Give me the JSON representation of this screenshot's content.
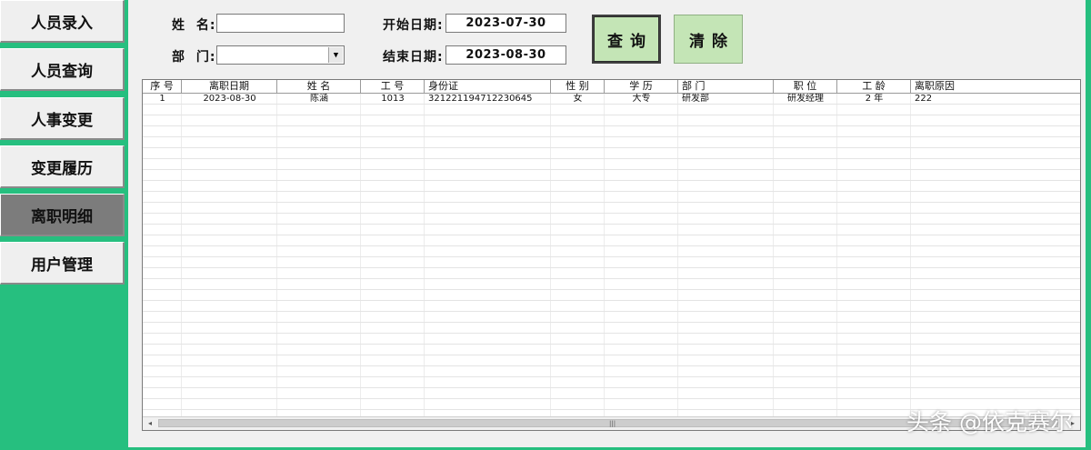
{
  "sidebar": {
    "items": [
      {
        "label": "人员录入",
        "active": false
      },
      {
        "label": "人员查询",
        "active": false
      },
      {
        "label": "人事变更",
        "active": false
      },
      {
        "label": "变更履历",
        "active": false
      },
      {
        "label": "离职明细",
        "active": true
      },
      {
        "label": "用户管理",
        "active": false
      }
    ]
  },
  "form": {
    "name_label": "姓  名:",
    "name_value": "",
    "dept_label": "部  门:",
    "dept_value": "",
    "start_label": "开始日期:",
    "start_value": "2023-07-30",
    "end_label": "结束日期:",
    "end_value": "2023-08-30"
  },
  "buttons": {
    "query_label": "查询",
    "clear_label": "清除"
  },
  "table": {
    "headers": [
      "序 号",
      "离职日期",
      "姓 名",
      "工 号",
      "身份证",
      "性 别",
      "学 历",
      "部 门",
      "职 位",
      "工 龄",
      "离职原因"
    ],
    "rows": [
      [
        "1",
        "2023-08-30",
        "陈涵",
        "1013",
        "321221194712230645",
        "女",
        "大专",
        "研发部",
        "研发经理",
        "2 年",
        "222"
      ]
    ]
  },
  "scrollbar": {
    "left_arrow": "◂",
    "right_arrow": "▸",
    "grip": "|||"
  },
  "watermark": "头条 @依克赛尔",
  "colors": {
    "background": "#26bf7f",
    "panel": "#f0f0f0",
    "active_nav": "#7c7c7c",
    "action_button": "#c4e5b6"
  }
}
